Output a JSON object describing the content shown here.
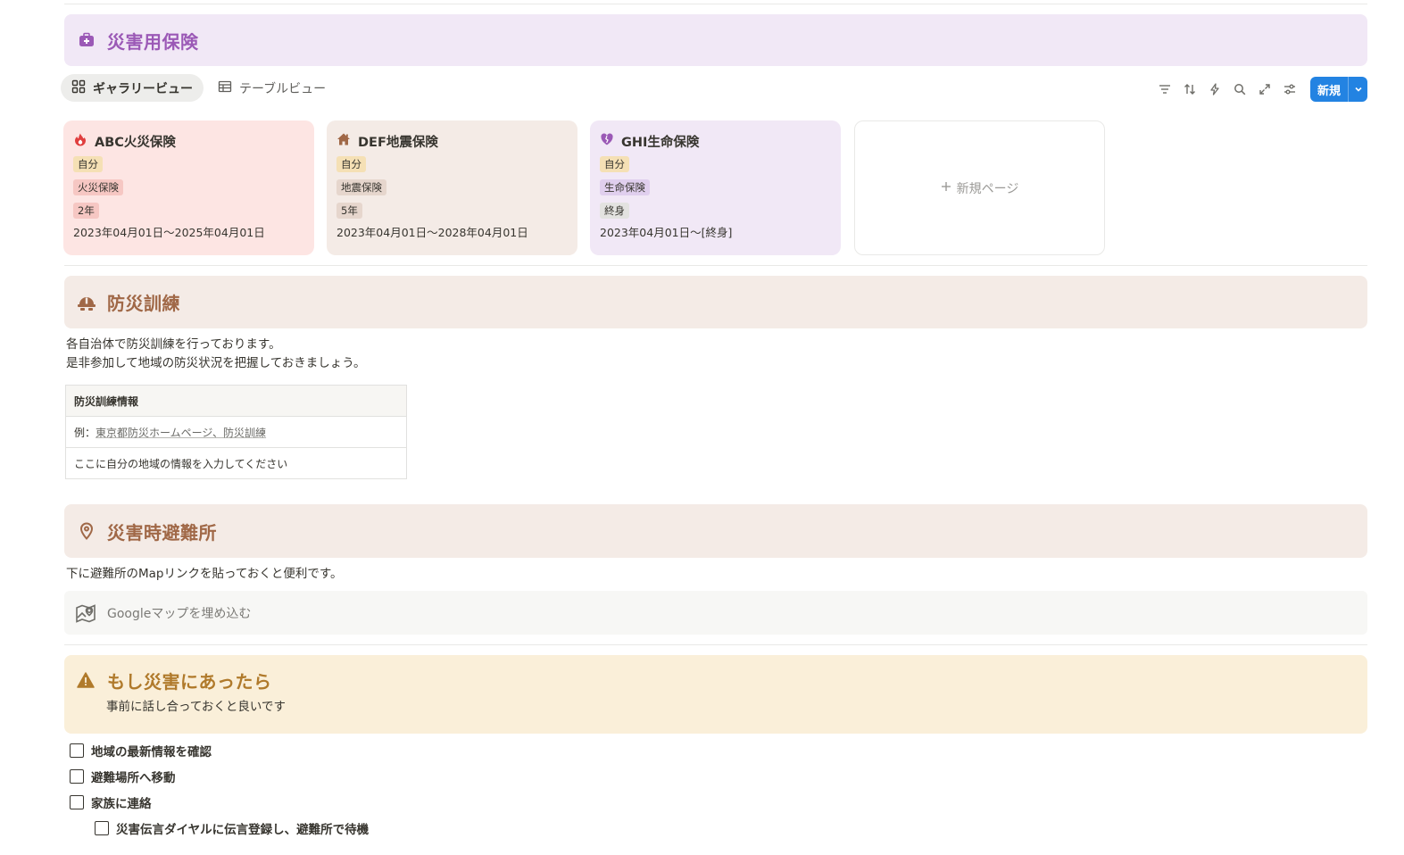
{
  "insurance": {
    "title": "災害用保険",
    "views": [
      {
        "label": "ギャラリービュー",
        "icon": "gallery-icon",
        "active": true
      },
      {
        "label": "テーブルビュー",
        "icon": "table-icon",
        "active": false
      }
    ],
    "toolbar_icons": [
      "filter-icon",
      "sort-icon",
      "lightning-icon",
      "search-icon",
      "expand-icon",
      "settings-icon"
    ],
    "new_button": "新規",
    "cards": [
      {
        "title": "ABC火災保険",
        "icon": "fire-icon",
        "owner": "自分",
        "type": "火災保険",
        "term": "2年",
        "period": "2023年04月01日〜2025年04月01日",
        "bg": "#fde5e3",
        "type_color": "#f6c7c3",
        "term_color": "#f6c7c3"
      },
      {
        "title": "DEF地震保険",
        "icon": "house-icon",
        "owner": "自分",
        "type": "地震保険",
        "term": "5年",
        "period": "2023年04月01日〜2028年04月01日",
        "bg": "#f4ebe6",
        "type_color": "#e6d6cd",
        "term_color": "#e6d6cd"
      },
      {
        "title": "GHI生命保険",
        "icon": "heart-icon",
        "owner": "自分",
        "type": "生命保険",
        "term": "終身",
        "period": "2023年04月01日〜[終身]",
        "bg": "#f1e8f6",
        "type_color": "#e0cfee",
        "term_color": "#e3e2e0"
      }
    ],
    "new_page": "新規ページ"
  },
  "drill": {
    "title": "防災訓練",
    "lines": [
      "各自治体で防災訓練を行っております。",
      "是非参加して地域の防災状況を把握しておきましょう。"
    ],
    "table": {
      "header": "防災訓練情報",
      "example_prefix": "例：",
      "example_link": "東京都防災ホームページ、防災訓練",
      "placeholder": "ここに自分の地域の情報を入力してください"
    }
  },
  "evacuation": {
    "title": "災害時避難所",
    "text": "下に避難所のMapリンクを貼っておくと便利です。",
    "embed_label": "Googleマップを埋め込む"
  },
  "emergency": {
    "title": "もし災害にあったら",
    "subtitle": "事前に話し合っておくと良いです",
    "todos": [
      {
        "label": "地域の最新情報を確認",
        "checked": false,
        "indent": 0
      },
      {
        "label": "避難場所へ移動",
        "checked": false,
        "indent": 0
      },
      {
        "label": "家族に連絡",
        "checked": false,
        "indent": 0
      },
      {
        "label": "災害伝言ダイヤルに伝言登録し、避難所で待機",
        "checked": false,
        "indent": 1
      }
    ]
  },
  "colors": {
    "insurance_accent": "#9b59b6",
    "drill_accent": "#a06847",
    "emergency_accent": "#b07a2b",
    "button_blue": "#2383e2",
    "owner_tag": "#f5e0b5"
  }
}
